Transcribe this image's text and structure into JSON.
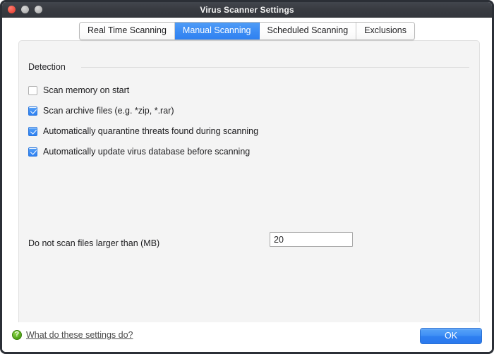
{
  "window": {
    "title": "Virus Scanner Settings",
    "traffic_lights": [
      {
        "name": "close",
        "color": "#ec4a3c"
      },
      {
        "name": "minimize",
        "color": "#b4b4b4"
      },
      {
        "name": "zoom",
        "color": "#b4b4b4"
      }
    ]
  },
  "tabs": [
    {
      "label": "Real Time Scanning",
      "active": false
    },
    {
      "label": "Manual Scanning",
      "active": true
    },
    {
      "label": "Scheduled Scanning",
      "active": false
    },
    {
      "label": "Exclusions",
      "active": false
    }
  ],
  "section": {
    "title": "Detection"
  },
  "checkboxes": [
    {
      "label": "Scan memory on start",
      "checked": false
    },
    {
      "label": "Scan archive files (e.g. *zip, *.rar)",
      "checked": true
    },
    {
      "label": "Automatically quarantine threats found during scanning",
      "checked": true
    },
    {
      "label": "Automatically update virus database before scanning",
      "checked": true
    }
  ],
  "size_limit": {
    "label": "Do not scan files larger than (MB)",
    "value": "20",
    "placeholder": ""
  },
  "footer": {
    "help_icon": "question-mark-icon",
    "help_link": "What do these settings do?",
    "ok_label": "OK"
  },
  "colors": {
    "accent": "#3d8df4",
    "titlebar": "#383b41",
    "panel": "#f4f4f4",
    "help_green": "#4fa216"
  }
}
